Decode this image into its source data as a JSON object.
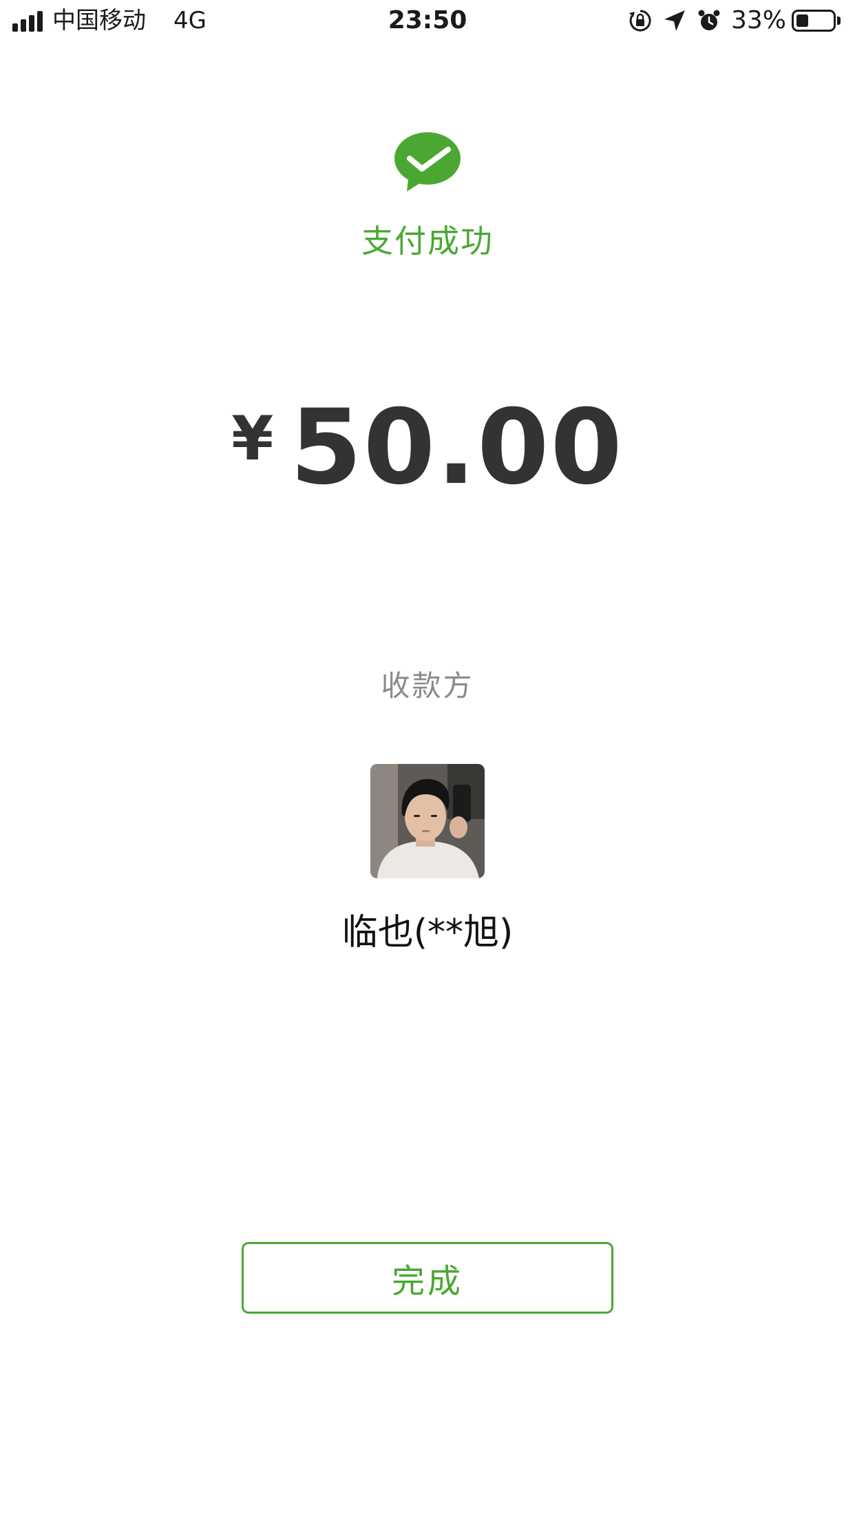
{
  "status_bar": {
    "carrier": "中国移动",
    "network": "4G",
    "time": "23:50",
    "battery_percent": "33%",
    "battery_level": 0.33,
    "icons": [
      "signal-icon",
      "orientation-lock-icon",
      "location-icon",
      "alarm-icon",
      "battery-icon"
    ]
  },
  "result": {
    "title": "支付成功",
    "icon": "wechat-pay-check-icon",
    "color": "#4aa832"
  },
  "amount": {
    "currency": "¥",
    "value": "50.00"
  },
  "payee": {
    "label": "收款方",
    "name": "临也(**旭)",
    "avatar": "payee-avatar-photo"
  },
  "actions": {
    "done_label": "完成"
  }
}
